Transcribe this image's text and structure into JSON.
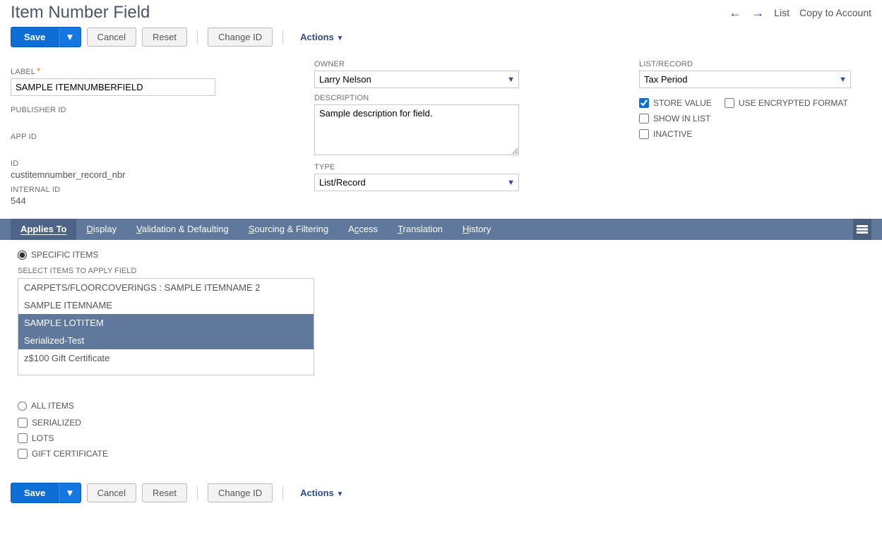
{
  "title": "Item Number Field",
  "topActions": {
    "list": "List",
    "copy": "Copy to Account"
  },
  "buttons": {
    "save": "Save",
    "cancel": "Cancel",
    "reset": "Reset",
    "changeId": "Change ID",
    "actions": "Actions"
  },
  "col1": {
    "labelLabel": "LABEL",
    "labelValue": "SAMPLE ITEMNUMBERFIELD",
    "publisherLabel": "PUBLISHER ID",
    "appIdLabel": "APP ID",
    "idLabel": "ID",
    "idValue": "custitemnumber_record_nbr",
    "internalIdLabel": "INTERNAL ID",
    "internalIdValue": "544"
  },
  "col2": {
    "ownerLabel": "OWNER",
    "ownerValue": "Larry Nelson",
    "descLabel": "DESCRIPTION",
    "descValue": "Sample description for field.",
    "typeLabel": "TYPE",
    "typeValue": "List/Record"
  },
  "col3": {
    "listRecordLabel": "LIST/RECORD",
    "listRecordValue": "Tax Period",
    "storeValue": "STORE VALUE",
    "encrypted": "USE ENCRYPTED FORMAT",
    "showInList": "SHOW IN LIST",
    "inactive": "INACTIVE"
  },
  "tabs": {
    "appliesTo": "Applies To",
    "display": "Display",
    "validation": "Validation & Defaulting",
    "sourcing": "Sourcing & Filtering",
    "access": "Access",
    "translation": "Translation",
    "history": "History"
  },
  "appliesTo": {
    "specificItems": "SPECIFIC ITEMS",
    "selectItemsLabel": "SELECT ITEMS TO APPLY FIELD",
    "items": [
      {
        "label": "CARPETS/FLOORCOVERINGS : SAMPLE ITEMNAME 2",
        "selected": false
      },
      {
        "label": "SAMPLE ITEMNAME",
        "selected": false
      },
      {
        "label": "SAMPLE LOTITEM",
        "selected": true
      },
      {
        "label": "Serialized-Test",
        "selected": true
      },
      {
        "label": "z$100 Gift Certificate",
        "selected": false
      }
    ],
    "allItems": "ALL ITEMS",
    "serialized": "SERIALIZED",
    "lots": "LOTS",
    "gift": "GIFT CERTIFICATE"
  }
}
